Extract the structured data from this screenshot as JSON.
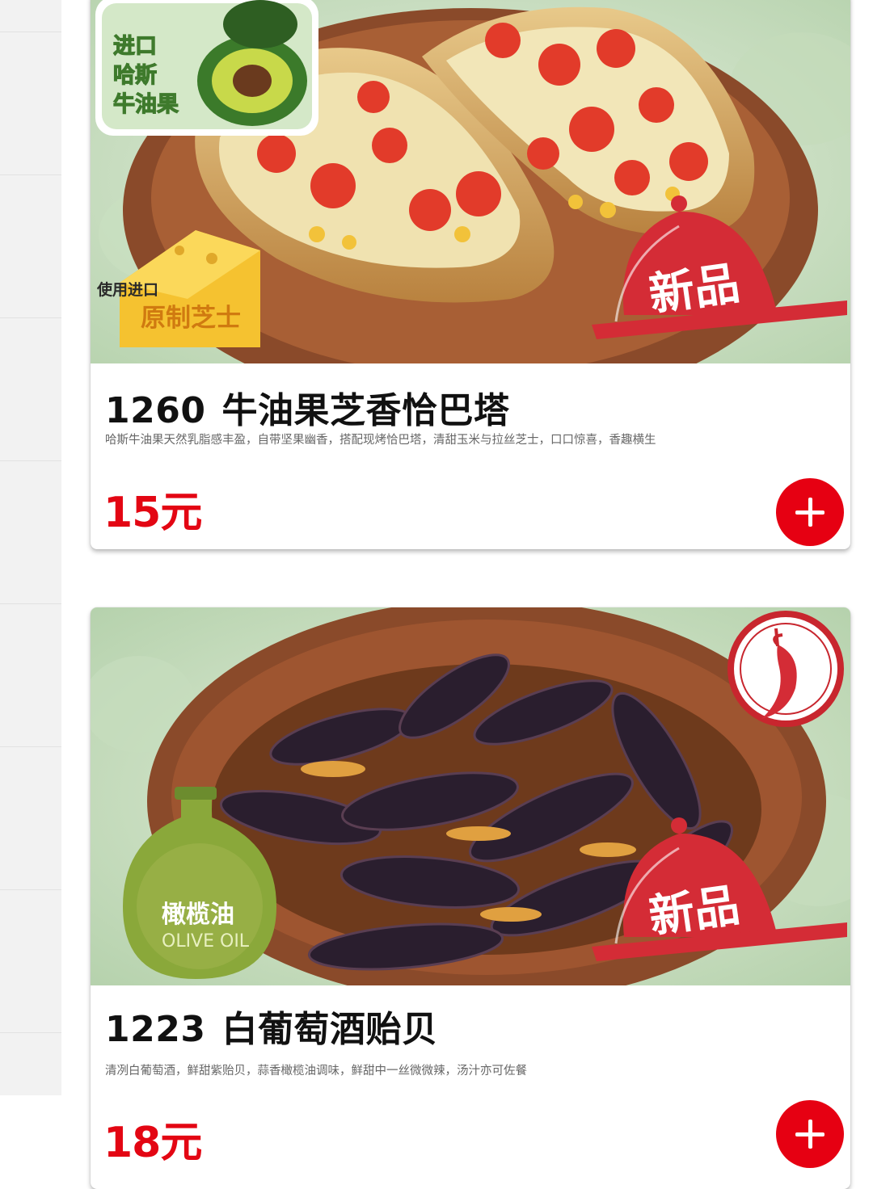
{
  "sidebar": {
    "category_count": 8
  },
  "items": [
    {
      "code": "1260",
      "name": "牛油果芝香恰巴塔",
      "description": "哈斯牛油果天然乳脂感丰盈，自带坚果幽香，搭配现烤恰巴塔，清甜玉米与拉丝芝士，口口惊喜，香趣横生",
      "price": "15元",
      "badges": {
        "avocado_line1": "进口",
        "avocado_line2": "哈斯",
        "avocado_line3": "牛油果",
        "cheese_line1": "使用进口",
        "cheese_line2": "原制芝士",
        "new_label": "新品"
      }
    },
    {
      "code": "1223",
      "name": "白葡萄酒贻贝",
      "description": "清冽白葡萄酒，鲜甜紫贻贝，蒜香橄榄油调味，鲜甜中一丝微微辣，汤汁亦可佐餐",
      "price": "18元",
      "badges": {
        "olive_cn": "橄榄油",
        "olive_en": "OLIVE OIL",
        "new_label": "新品",
        "spicy_icon": "chili-pepper-icon"
      }
    }
  ],
  "colors": {
    "brand_red": "#e30613",
    "add_button": "#e60012",
    "bowl": "#8a4a2a",
    "background_green": "#cfe3c6"
  }
}
